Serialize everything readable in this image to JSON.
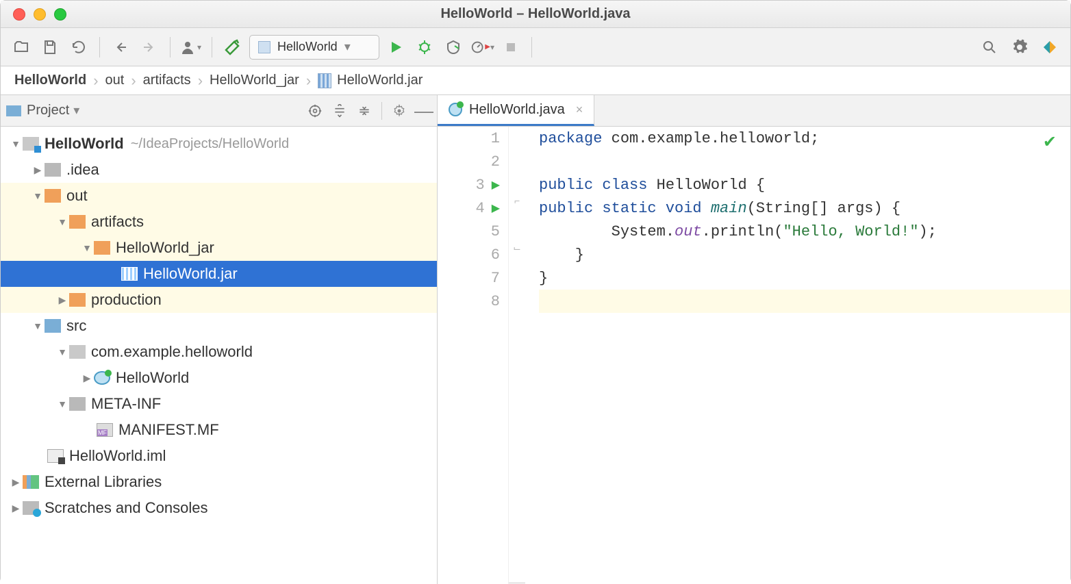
{
  "window": {
    "title": "HelloWorld – HelloWorld.java"
  },
  "toolbar": {
    "runConfig": "HelloWorld"
  },
  "breadcrumb": {
    "items": [
      "HelloWorld",
      "out",
      "artifacts",
      "HelloWorld_jar",
      "HelloWorld.jar"
    ]
  },
  "projectPanel": {
    "title": "Project",
    "root": {
      "name": "HelloWorld",
      "path": "~/IdeaProjects/HelloWorld"
    },
    "nodes": {
      "idea": ".idea",
      "out": "out",
      "artifacts": "artifacts",
      "jarFolder": "HelloWorld_jar",
      "jarFile": "HelloWorld.jar",
      "production": "production",
      "src": "src",
      "pkg": "com.example.helloworld",
      "cls": "HelloWorld",
      "metainf": "META-INF",
      "manifest": "MANIFEST.MF",
      "iml": "HelloWorld.iml",
      "extlib": "External Libraries",
      "scratches": "Scratches and Consoles"
    }
  },
  "editor": {
    "tabName": "HelloWorld.java",
    "gutterLines": [
      "1",
      "2",
      "3",
      "4",
      "5",
      "6",
      "7",
      "8"
    ],
    "code": {
      "l1_kw": "package",
      "l1_rest": " com.example.helloworld;",
      "l3_kw": "public class",
      "l3_name": " HelloWorld {",
      "l4_kw": "public static void",
      "l4_fn": " main",
      "l4_rest": "(String[] args) {",
      "l5_pre": "        System.",
      "l5_out": "out",
      "l5_mid": ".println(",
      "l5_str": "\"Hello, World!\"",
      "l5_end": ");",
      "l6": "    }",
      "l7": "}"
    }
  }
}
